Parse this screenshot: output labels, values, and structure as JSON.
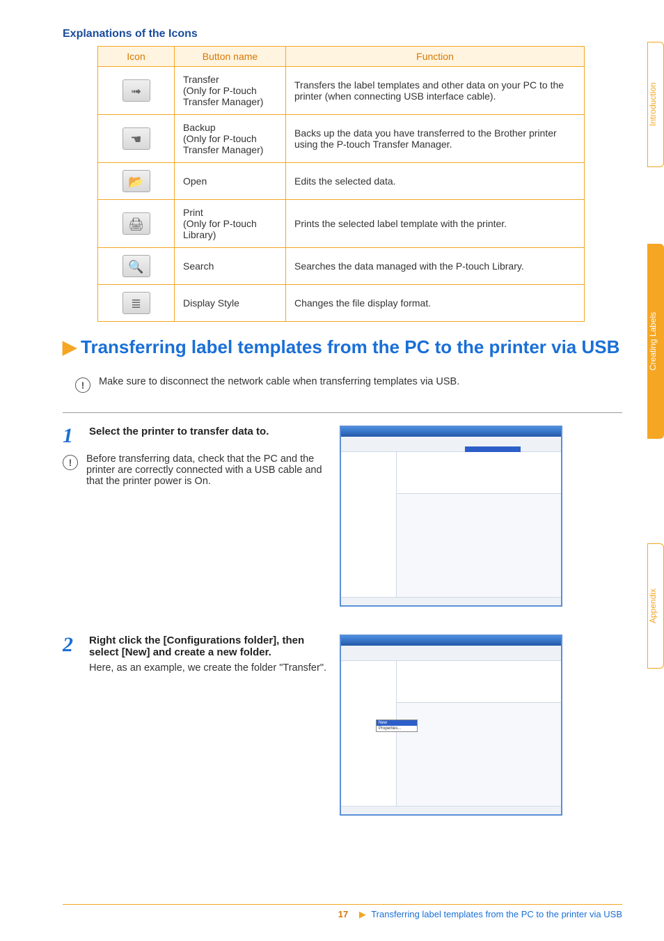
{
  "side_tabs": {
    "intro": "Introduction",
    "creating": "Creating Labels",
    "appendix": "Appendix"
  },
  "headings": {
    "explanations": "Explanations of the Icons",
    "main": "Transferring label templates from the PC to the printer via USB"
  },
  "table": {
    "headers": {
      "icon": "Icon",
      "name": "Button name",
      "func": "Function"
    },
    "rows": [
      {
        "name": "Transfer\n(Only for P-touch Transfer Manager)",
        "func": "Transfers the label templates and other data on your PC to the printer (when connecting USB interface cable).",
        "glyph": "➟"
      },
      {
        "name": "Backup\n(Only for P-touch Transfer Manager)",
        "func": "Backs up the data you have transferred to the Brother printer using the P-touch Transfer Manager.",
        "glyph": "☚"
      },
      {
        "name": "Open",
        "func": "Edits the selected data.",
        "glyph": "📂"
      },
      {
        "name": "Print\n(Only for P-touch Library)",
        "func": "Prints the selected label template with the printer.",
        "glyph": "🖨"
      },
      {
        "name": "Search",
        "func": "Searches the data managed with the P-touch Library.",
        "glyph": "🔍"
      },
      {
        "name": "Display Style",
        "func": "Changes the file display format.",
        "glyph": "≣"
      }
    ]
  },
  "notes": {
    "disconnect": "Make sure to disconnect the network cable when transferring templates via USB.",
    "before_transfer": "Before transferring data, check that the PC and the printer are correctly connected with a USB cable and that the printer power is On."
  },
  "steps": {
    "s1": {
      "title": "Select the printer to transfer data to."
    },
    "s2": {
      "title": "Right click the [Configurations folder], then select [New] and create a new folder.",
      "body": "Here, as an example, we create the folder \"Transfer\"."
    }
  },
  "footer": {
    "page": "17",
    "link": "Transferring label templates from the PC to the printer via USB"
  }
}
